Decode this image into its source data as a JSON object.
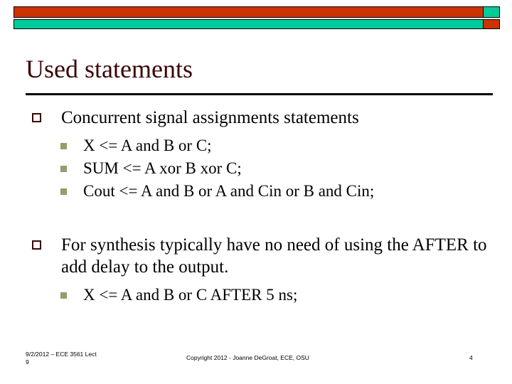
{
  "slide": {
    "title": "Used statements",
    "page_number": "4"
  },
  "decor": {
    "bar_red": "#CC3300",
    "bar_teal": "#00CC99",
    "bar_border": "#000000",
    "top_bar_long_color": "#CC3300",
    "top_bar_short_color": "#00CC99",
    "bottom_bar_long_color": "#00CC99",
    "bottom_bar_short_color": "#CC3300"
  },
  "theme": {
    "title_color": "#3B0404",
    "level1_marker_color": "#3B0404",
    "level2_marker_color": "#9A9A6B",
    "body_text_color": "#000000",
    "rule_color": "#000000"
  },
  "content": {
    "blocks": [
      {
        "level1": "Concurrent signal assignments statements",
        "level2": [
          "X <= A and B or C;",
          "SUM <= A xor B xor C;",
          "Cout <= A and B or A and Cin or B and Cin;"
        ]
      },
      {
        "level1": "For synthesis typically have no need of using the AFTER to add delay to the output.",
        "level2": [
          "X <= A and B or C AFTER 5 ns;"
        ]
      }
    ]
  },
  "footer": {
    "left_line1": "9/2/2012 – ECE 3561 Lect",
    "left_line2": "9",
    "copyright": "Copyright 2012 - Joanne DeGroat, ECE, OSU",
    "page_number": "4"
  }
}
